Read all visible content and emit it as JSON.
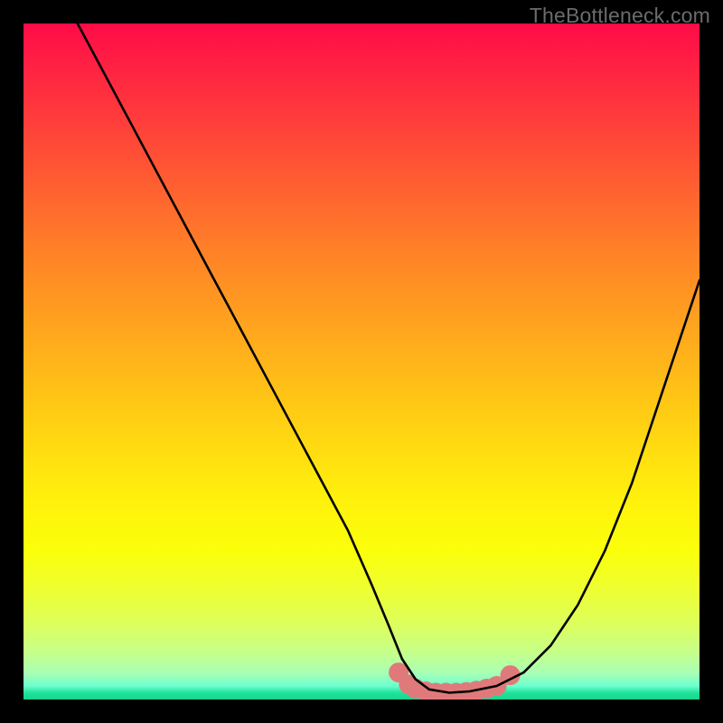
{
  "watermark": "TheBottleneck.com",
  "chart_data": {
    "type": "line",
    "title": "",
    "xlabel": "",
    "ylabel": "",
    "xlim": [
      0,
      100
    ],
    "ylim": [
      0,
      100
    ],
    "legend": false,
    "background": "red-yellow-green gradient (bottleneck heatmap)",
    "series": [
      {
        "name": "bottleneck-curve",
        "color": "#000000",
        "x": [
          8,
          12,
          16,
          20,
          24,
          28,
          32,
          36,
          40,
          44,
          48,
          51.5,
          54,
          56,
          58,
          60,
          63,
          66,
          70,
          74,
          78,
          82,
          86,
          90,
          94,
          98,
          100
        ],
        "y": [
          100,
          92.5,
          85,
          77.5,
          70,
          62.5,
          55,
          47.5,
          40,
          32.5,
          25,
          17,
          11,
          6,
          3,
          1.5,
          1,
          1.2,
          2,
          4,
          8,
          14,
          22,
          32,
          44,
          56,
          62
        ]
      }
    ],
    "markers": [
      {
        "name": "marker-cluster",
        "shape": "circle",
        "color": "#e07a7a",
        "radius_px": 11,
        "points": [
          {
            "x": 55.5,
            "y": 4.0
          },
          {
            "x": 57.0,
            "y": 2.2
          },
          {
            "x": 58.0,
            "y": 1.6
          },
          {
            "x": 59.5,
            "y": 1.2
          },
          {
            "x": 61.0,
            "y": 1.0
          },
          {
            "x": 62.5,
            "y": 1.0
          },
          {
            "x": 64.0,
            "y": 1.0
          },
          {
            "x": 65.5,
            "y": 1.1
          },
          {
            "x": 67.0,
            "y": 1.3
          },
          {
            "x": 68.5,
            "y": 1.6
          },
          {
            "x": 70.0,
            "y": 2.0
          },
          {
            "x": 72.0,
            "y": 3.6
          }
        ]
      }
    ]
  }
}
